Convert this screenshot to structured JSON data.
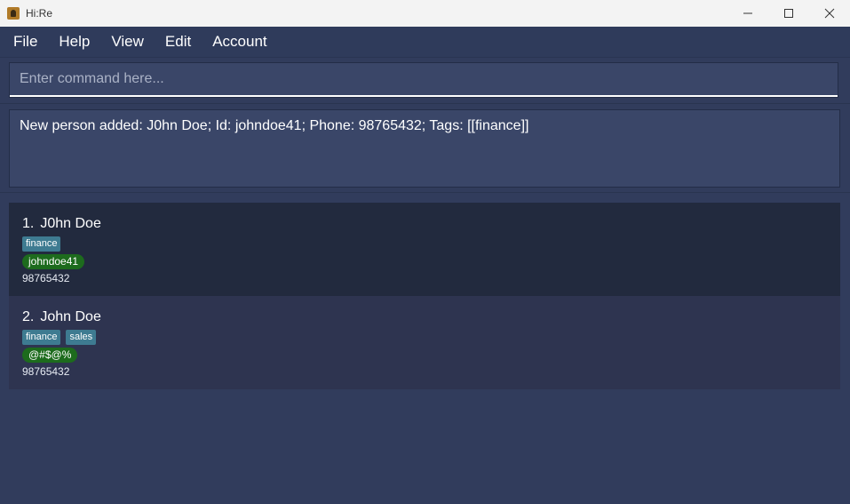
{
  "window": {
    "title": "Hi:Re"
  },
  "menu": [
    "File",
    "Help",
    "View",
    "Edit",
    "Account"
  ],
  "command": {
    "value": "",
    "placeholder": "Enter command here..."
  },
  "result": {
    "text": "New person added: J0hn Doe; Id: johndoe41; Phone: 98765432; Tags: [[finance]]"
  },
  "persons": [
    {
      "index": "1.",
      "name": "J0hn Doe",
      "tags": [
        "finance"
      ],
      "id": "johndoe41",
      "phone": "98765432"
    },
    {
      "index": "2.",
      "name": "John Doe",
      "tags": [
        "finance",
        "sales"
      ],
      "id": "@#$@%",
      "phone": "98765432"
    }
  ],
  "colors": {
    "background": "#313c5c",
    "tag": "#3e7b91",
    "id_badge": "#1d6b1d"
  }
}
